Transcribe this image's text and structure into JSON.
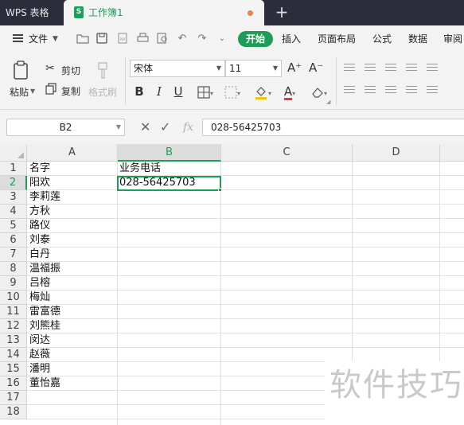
{
  "titlebar": {
    "app_tab": "WPS 表格",
    "doc_icon": "S",
    "doc_title": "工作簿1",
    "new_tab": "+"
  },
  "menubar": {
    "file": "文件",
    "items": [
      "开始",
      "插入",
      "页面布局",
      "公式",
      "数据",
      "审阅"
    ]
  },
  "ribbon": {
    "paste": "粘贴",
    "cut": "剪切",
    "copy": "复制",
    "format_painter": "格式刷",
    "font_name": "宋体",
    "font_size": "11",
    "grow_font": "A⁺",
    "shrink_font": "A⁻",
    "bold": "B",
    "italic": "I",
    "underline": "U",
    "font_color_letter": "A"
  },
  "formula_bar": {
    "name_box": "B2",
    "fx": "fx",
    "value": "028-56425703"
  },
  "grid": {
    "columns": [
      "A",
      "B",
      "C",
      "D"
    ],
    "rows": [
      "1",
      "2",
      "3",
      "4",
      "5",
      "6",
      "7",
      "8",
      "9",
      "10",
      "11",
      "12",
      "13",
      "14",
      "15",
      "16",
      "17",
      "18"
    ],
    "column_a": [
      "名字",
      "阳欢",
      "李莉莲",
      "方秋",
      "路仪",
      "刘泰",
      "白丹",
      "温福振",
      "吕榕",
      "梅灿",
      "雷富德",
      "刘熊桂",
      "闵达",
      "赵薇",
      "潘明",
      "董怡嘉"
    ],
    "b1": "业务电话",
    "b2": "028-56425703",
    "selected_cell": "B2"
  },
  "watermark": "软件技巧",
  "colors": {
    "accent": "#1f9c58",
    "titlebar": "#2b2e3a",
    "toolbar": "#f3f3f3"
  }
}
